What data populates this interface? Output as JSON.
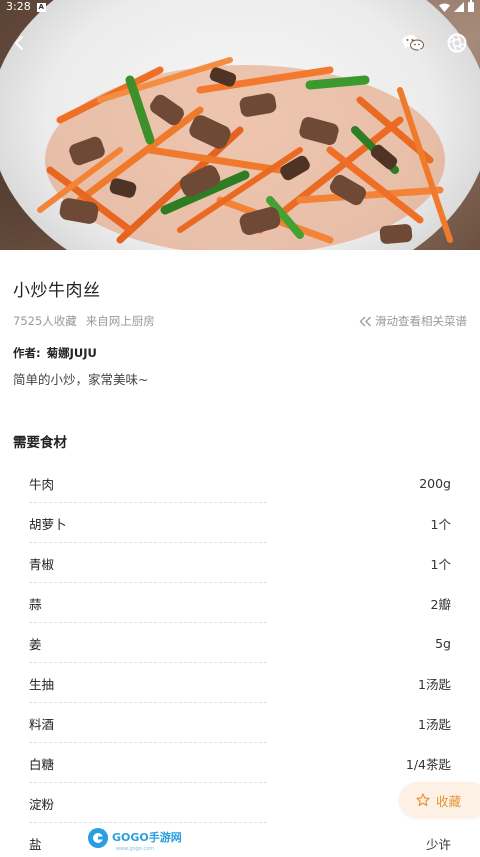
{
  "status_bar": {
    "time": "3:28",
    "badge": "A"
  },
  "recipe": {
    "title": "小炒牛肉丝",
    "favorites": "7525人收藏",
    "source": "来自网上厨房",
    "related_hint": "滑动查看相关菜谱",
    "author_label": "作者:",
    "author_name": "菊娜JUJU",
    "description": "简单的小炒，家常美味~"
  },
  "ingredients_section": {
    "title": "需要食材",
    "items": [
      {
        "name": "牛肉",
        "qty": "200g"
      },
      {
        "name": "胡萝卜",
        "qty": "1个"
      },
      {
        "name": "青椒",
        "qty": "1个"
      },
      {
        "name": "蒜",
        "qty": "2瓣"
      },
      {
        "name": "姜",
        "qty": "5g"
      },
      {
        "name": "生抽",
        "qty": "1汤匙"
      },
      {
        "name": "料酒",
        "qty": "1汤匙"
      },
      {
        "name": "白糖",
        "qty": "1/4茶匙"
      },
      {
        "name": "淀粉",
        "qty": ""
      },
      {
        "name": "盐",
        "qty": "少许"
      }
    ]
  },
  "favorite_button": {
    "label": "收藏"
  },
  "watermark": {
    "text": "GOGO手游网",
    "subtext": "www.gogo.com"
  },
  "colors": {
    "accent": "#e8953a",
    "accent_bg": "#fdf1e6",
    "muted": "#9a9a9a"
  },
  "icons": [
    "back-arrow-icon",
    "wechat-icon",
    "camera-shutter-icon",
    "double-chevron-left-icon",
    "star-icon"
  ]
}
